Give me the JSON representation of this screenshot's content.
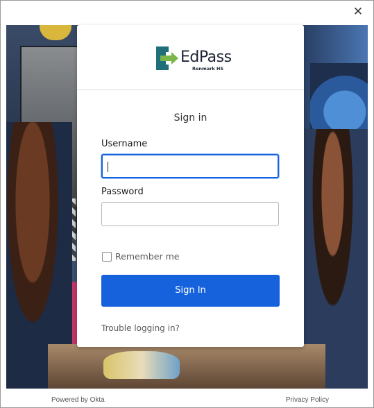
{
  "window": {
    "close_glyph": "✕"
  },
  "brand": {
    "name": "EdPass",
    "subname": "Renmark HS",
    "colors": {
      "mark_teal": "#1f6f7a",
      "mark_green": "#7ab648",
      "mark_dark": "#1e2433"
    }
  },
  "form": {
    "title": "Sign in",
    "username_label": "Username",
    "username_value": "",
    "password_label": "Password",
    "password_value": "",
    "remember_label": "Remember me",
    "remember_checked": false,
    "submit_label": "Sign In",
    "help_link": "Trouble logging in?"
  },
  "footer": {
    "powered_by": "Powered by Okta",
    "privacy": "Privacy Policy"
  },
  "colors": {
    "accent": "#1662dd",
    "card_bg": "#ffffff",
    "text": "#1d1d21",
    "muted": "#5a5a5a"
  },
  "icons": {
    "close": "close-icon",
    "logo": "edpass-logo-icon"
  }
}
